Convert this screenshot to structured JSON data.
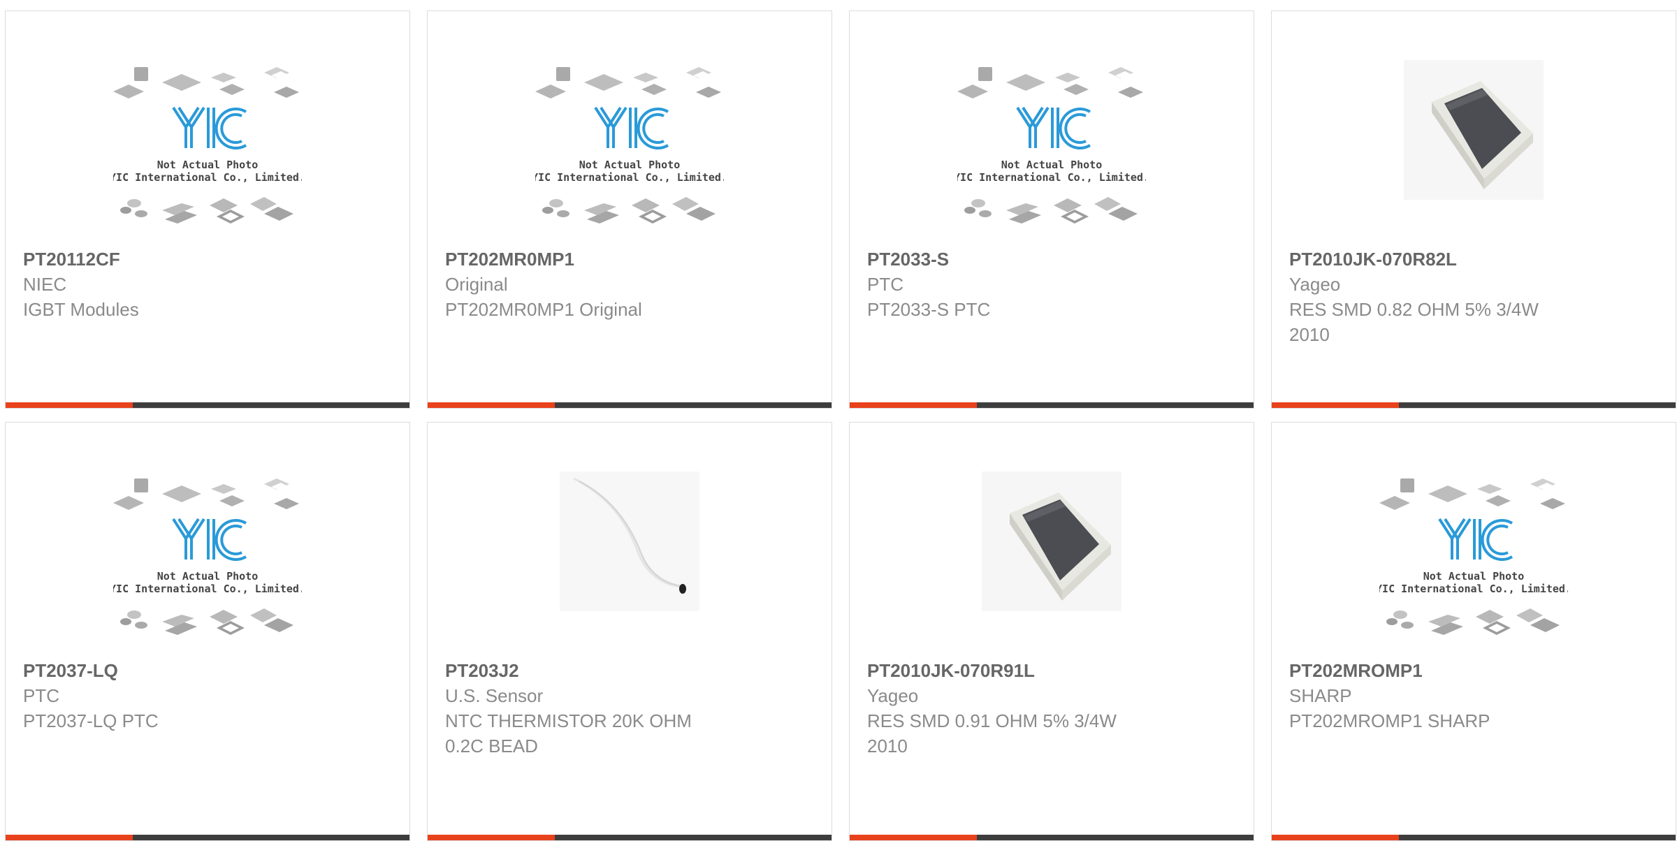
{
  "colors": {
    "accent": "#e8421c",
    "bar": "#3d3d3d",
    "part_number": "#666666",
    "text": "#8a8a8a",
    "yic_blue": "#2a9ad8"
  },
  "placeholder": {
    "line1": "Not Actual Photo",
    "line2": "YIC International Co., Limited."
  },
  "products": [
    {
      "part_number": "PT20112CF",
      "manufacturer": "NIEC",
      "description": "IGBT Modules",
      "image": "yic-placeholder"
    },
    {
      "part_number": "PT202MR0MP1",
      "manufacturer": "Original",
      "description": "PT202MR0MP1 Original",
      "image": "yic-placeholder"
    },
    {
      "part_number": "PT2033-S",
      "manufacturer": "PTC",
      "description": "PT2033-S PTC",
      "image": "yic-placeholder"
    },
    {
      "part_number": "PT2010JK-070R82L",
      "manufacturer": "Yageo",
      "description": "RES SMD 0.82 OHM 5% 3/4W 2010",
      "image": "smd-resistor"
    },
    {
      "part_number": "PT2037-LQ",
      "manufacturer": "PTC",
      "description": "PT2037-LQ PTC",
      "image": "yic-placeholder"
    },
    {
      "part_number": "PT203J2",
      "manufacturer": "U.S. Sensor",
      "description": "NTC THERMISTOR 20K OHM 0.2C BEAD",
      "image": "thermistor"
    },
    {
      "part_number": "PT2010JK-070R91L",
      "manufacturer": "Yageo",
      "description": "RES SMD 0.91 OHM 5% 3/4W 2010",
      "image": "smd-resistor"
    },
    {
      "part_number": "PT202MROMP1",
      "manufacturer": "SHARP",
      "description": "PT202MROMP1 SHARP",
      "image": "yic-placeholder"
    }
  ]
}
